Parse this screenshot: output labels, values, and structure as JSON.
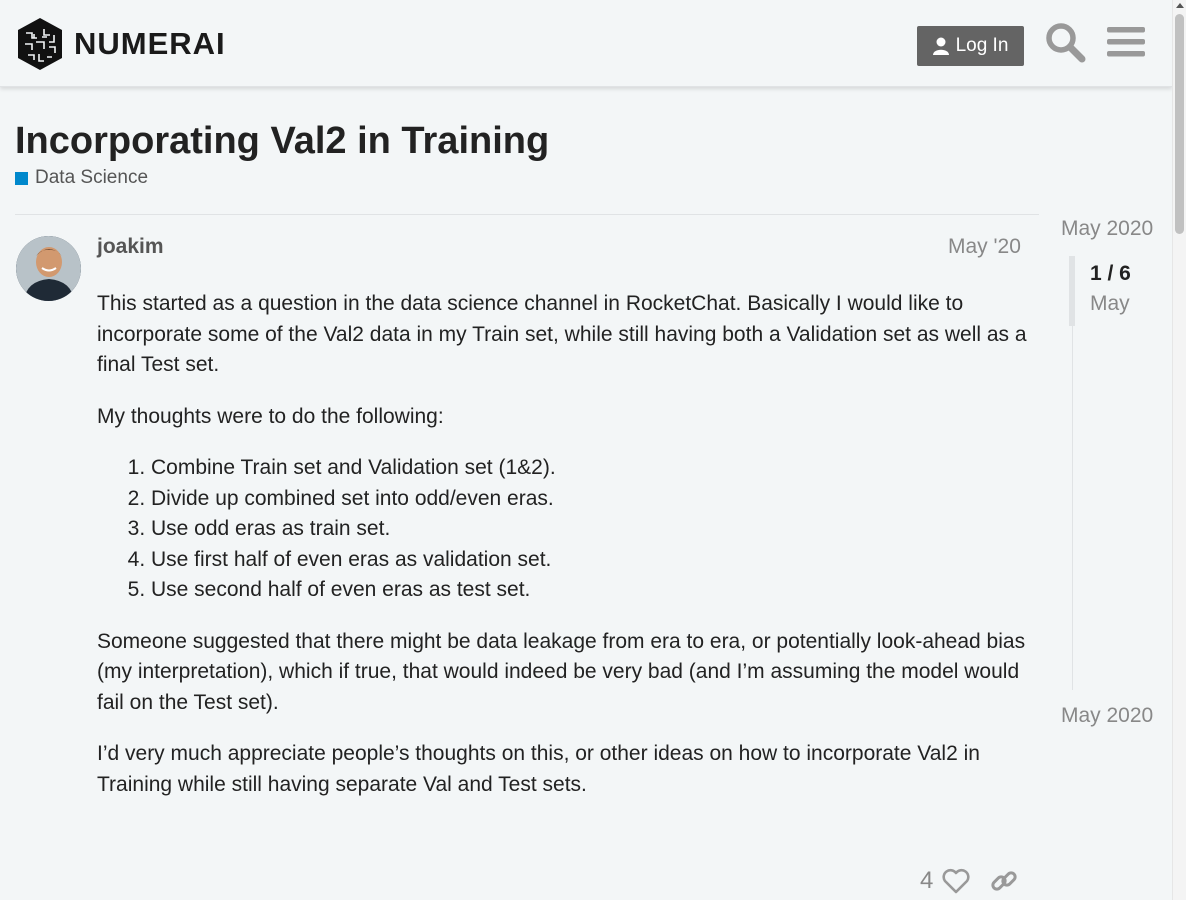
{
  "header": {
    "logo_text": "NUMERAI",
    "login_label": "Log In",
    "icons": [
      "numerai-logo-icon",
      "user-icon",
      "search-icon",
      "menu-icon"
    ]
  },
  "topic": {
    "title": "Incorporating Val2 in Training",
    "category": "Data Science",
    "category_color": "#0088cc"
  },
  "post": {
    "username": "joakim",
    "date": "May '20",
    "paragraphs": [
      "This started as a question in the data science channel in RocketChat. Basically I would like to incorporate some of the Val2 data in my Train set, while still having both a Validation set as well as a final Test set.",
      "My thoughts were to do the following:"
    ],
    "list": [
      "Combine Train set and Validation set (1&2).",
      "Divide up combined set into odd/even eras.",
      "Use odd eras as train set.",
      "Use first half of even eras as validation set.",
      "Use second half of even eras as test set."
    ],
    "paragraphs_after": [
      "Someone suggested that there might be data leakage from era to era, or potentially look-ahead bias (my interpretation), which if true, that would indeed be very bad (and I’m assuming the model would fail on the Test set).",
      "I’d very much appreciate people’s thoughts on this, or other ideas on how to incorporate Val2 in Training while still having separate Val and Test sets."
    ],
    "like_count": "4"
  },
  "timeline": {
    "start_date": "May 2020",
    "position": "1 / 6",
    "position_date": "May",
    "end_date": "May 2020"
  }
}
